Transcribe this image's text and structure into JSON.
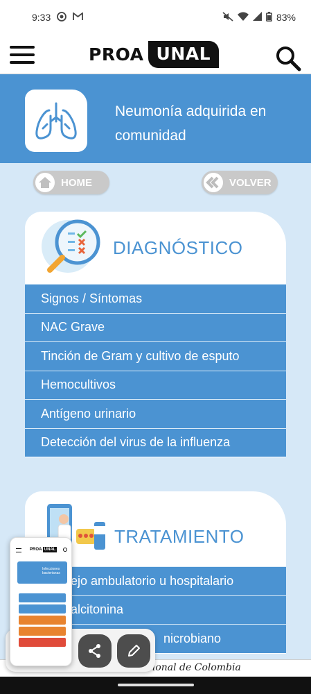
{
  "status_bar": {
    "time": "9:33",
    "battery": "83%",
    "icons": [
      "face-circle-icon",
      "gmail-icon",
      "mute-icon",
      "wifi-icon",
      "signal-icon",
      "battery-icon"
    ]
  },
  "header": {
    "logo_left": "PROA",
    "logo_right": "UNAL",
    "menu_icon": "hamburger-icon",
    "search_icon": "search-icon"
  },
  "hero": {
    "title": "Neumonía adquirida en comunidad",
    "icon": "lungs-icon"
  },
  "nav": {
    "home_label": "HOME",
    "back_label": "VOLVER"
  },
  "sections": [
    {
      "title": "DIAGNÓSTICO",
      "icon": "magnifier-checklist-icon",
      "items": [
        "Signos / Síntomas",
        "NAC Grave",
        "Tinción de Gram y cultivo de esputo",
        "Hemocultivos",
        "Antígeno urinario",
        "Detección del virus de la influenza"
      ]
    },
    {
      "title": "TRATAMIENTO",
      "icon": "doctor-medicine-icon",
      "items": [
        "ejo ambulatorio u hospitalario",
        "alcitonina",
        "nicrobiano"
      ]
    }
  ],
  "footer": {
    "text": "cional de Colombia"
  },
  "overlay": {
    "share_icon": "share-icon",
    "edit_icon": "pencil-icon",
    "preview_logo_left": "PROA",
    "preview_logo_right": "UNAL",
    "preview_title": "Infecciones bacterianas",
    "preview_rows": [
      {
        "color": "#4b93d2"
      },
      {
        "color": "#4b93d2"
      },
      {
        "color": "#e8832f"
      },
      {
        "color": "#e8832f"
      },
      {
        "color": "#e04b3a"
      }
    ]
  }
}
